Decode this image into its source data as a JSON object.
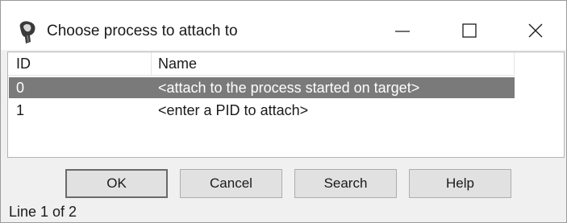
{
  "window": {
    "title": "Choose process to attach to",
    "icon": "bug-app-icon",
    "controls": [
      "minimize-icon",
      "maximize-icon",
      "close-icon"
    ]
  },
  "list": {
    "columns": [
      "ID",
      "Name"
    ],
    "rows": [
      {
        "id": "0",
        "name": "<attach to the process started on target>",
        "selected": true
      },
      {
        "id": "1",
        "name": "<enter a PID to attach>",
        "selected": false
      }
    ]
  },
  "buttons": {
    "ok": "OK",
    "cancel": "Cancel",
    "search": "Search",
    "help": "Help"
  },
  "status": {
    "text": "Line 1 of 2"
  },
  "colors": {
    "selection": "#7a7a7a",
    "dialog_bg": "#f0f0f0",
    "button_bg": "#e1e1e1"
  }
}
